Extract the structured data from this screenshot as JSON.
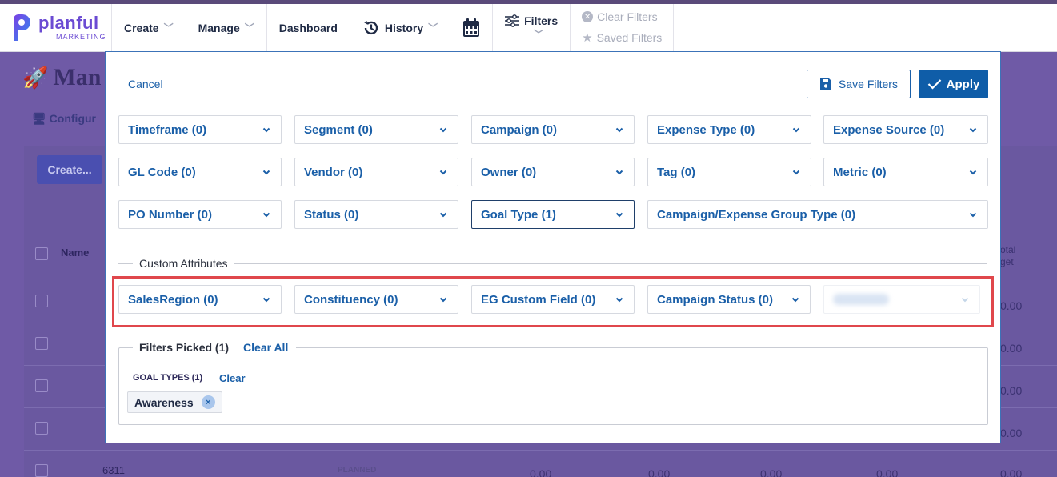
{
  "app": {
    "logo_name": "planful",
    "logo_sub": "MARKETING"
  },
  "nav": {
    "create": "Create",
    "manage": "Manage",
    "dashboard": "Dashboard",
    "history": "History",
    "filters": "Filters",
    "clear_filters": "Clear Filters",
    "saved_filters": "Saved Filters"
  },
  "background": {
    "title": "Man",
    "configure": "Configur",
    "create_button": "Create...",
    "name_column": "Name",
    "total_budget_1": "otal",
    "total_budget_2": "get",
    "row_code": "6311",
    "row_status": "PLANNED",
    "values": [
      "0.00",
      "0.00",
      "0.00",
      "0.00",
      "0.00"
    ],
    "bottom_values": [
      "0.00",
      "0.00",
      "0.00",
      "0.00",
      "0.00"
    ]
  },
  "modal": {
    "cancel": "Cancel",
    "save_filters": "Save Filters",
    "apply": "Apply",
    "filters": [
      "Timeframe (0)",
      "Segment (0)",
      "Campaign (0)",
      "Expense Type (0)",
      "Expense Source (0)",
      "GL Code (0)",
      "Vendor (0)",
      "Owner (0)",
      "Tag (0)",
      "Metric (0)",
      "PO Number (0)",
      "Status (0)",
      "Goal Type (1)",
      "Campaign/Expense Group Type (0)"
    ],
    "custom_attributes_label": "Custom Attributes",
    "custom_attributes": [
      "SalesRegion (0)",
      "Constituency (0)",
      "EG Custom Field (0)",
      "Campaign Status (0)"
    ],
    "filters_picked_label": "Filters Picked (1)",
    "clear_all": "Clear All",
    "goal_types_label": "GOAL TYPES (1)",
    "goal_types_clear": "Clear",
    "chip_label": "Awareness",
    "chip_remove": "×"
  },
  "colors": {
    "accent": "#1a5fa8",
    "overlay": "#6f5aa6",
    "highlight": "#e0474c"
  }
}
